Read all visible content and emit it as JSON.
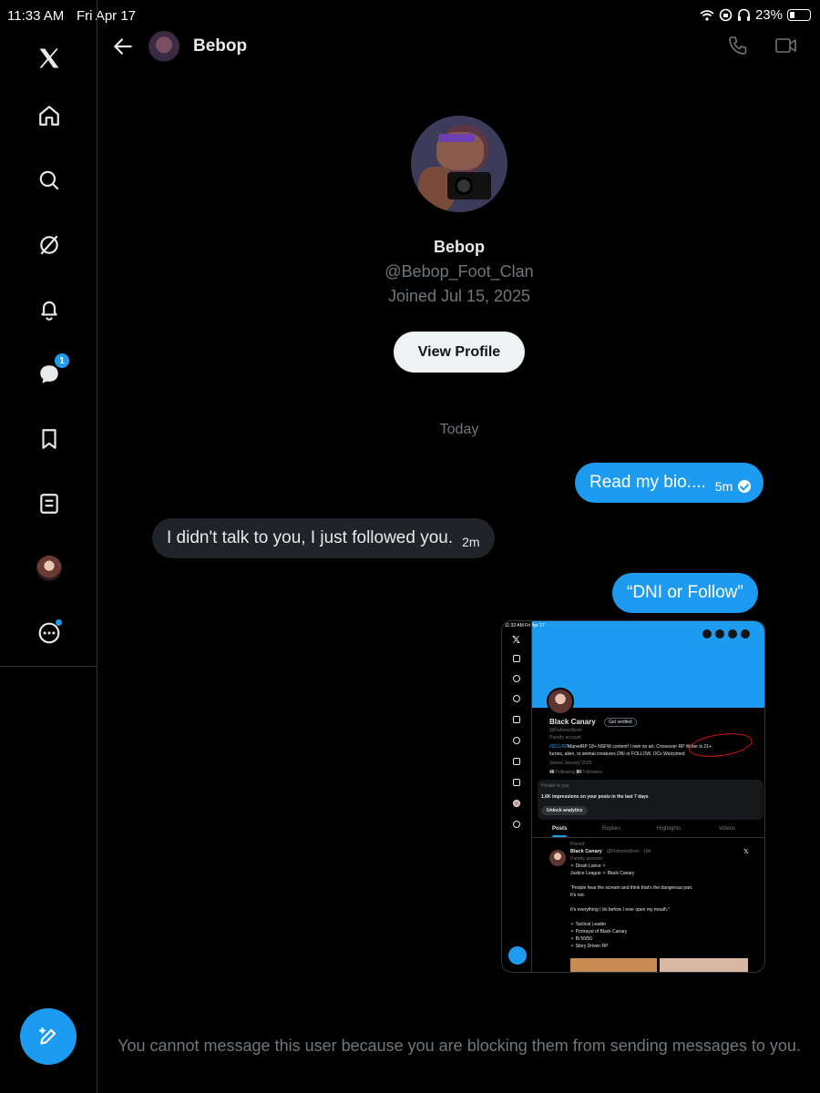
{
  "status_bar": {
    "time": "11:33 AM",
    "date": "Fri Apr 17",
    "battery": "23%",
    "battery_level": 0.23
  },
  "sidebar": {
    "items": [
      {
        "name": "x-logo"
      },
      {
        "name": "home-icon"
      },
      {
        "name": "search-icon"
      },
      {
        "name": "grok-icon"
      },
      {
        "name": "notifications-icon"
      },
      {
        "name": "messages-icon",
        "badge": "1"
      },
      {
        "name": "bookmarks-icon"
      },
      {
        "name": "lists-icon"
      },
      {
        "name": "profile-avatar"
      },
      {
        "name": "more-icon"
      }
    ],
    "compose_icon": "compose-icon"
  },
  "header": {
    "name": "Bebop"
  },
  "profile": {
    "name": "Bebop",
    "handle": "@Bebop_Foot_Clan",
    "joined": "Joined Jul 15, 2025",
    "view_profile": "View Profile"
  },
  "day_separator": "Today",
  "messages": [
    {
      "direction": "sent",
      "text": "Read my bio....",
      "time": "5m",
      "read": true
    },
    {
      "direction": "received",
      "text": "I didn't talk to you, I just followed you.",
      "time": "2m"
    },
    {
      "direction": "sent",
      "text": "“DNI or Follow”"
    }
  ],
  "attachment": {
    "status_time": "11:32 AM",
    "status_date": "Fri Apr 17",
    "name": "Black Canary",
    "get_verified": "Get verified",
    "handle": "@FishnetsSiren",
    "parody": "Parody account",
    "bio_tag": "#DCURP",
    "bio_line1": "MarvelRP 18+ NSFW content! I own no art. Crossover RP Writer is 21+.",
    "bio_line2": "furries, alien, or animal creatures DNI or FOLLOW. OCs Welcomed",
    "joined": "Joined January 2025",
    "following_count": "46",
    "following_label": "Following",
    "followers_count": "80",
    "followers_label": "Followers",
    "private_label": "Private to you",
    "impressions": "1.6K impressions on your posts in the last 7 days",
    "unlock": "Unlock analytics",
    "tabs": [
      "Posts",
      "Replies",
      "Highlights",
      "Videos"
    ],
    "pinned": "Pinned",
    "post_name": "Black Canary",
    "post_handle": "@FishnetsSiren · 18h",
    "post_parody": "Parody account",
    "post_lines": [
      "✧ Dinah Lance ✧",
      "Justice League ✧ Black Canary",
      "",
      "“People hear the scream and think that’s the dangerous part.",
      "It’s not.",
      "",
      "It’s everything I do before I ever open my mouth.”",
      "",
      "✧ Tactical Leader",
      "✧ Portrayal of Black Canary",
      "✧ Bi 50/50",
      "✧ Story Driven RP"
    ]
  },
  "footer": "You cannot message this user because you are blocking them from sending messages to you.",
  "colors": {
    "accent": "#1d9bf0",
    "background": "#000000",
    "muted": "#71767b",
    "received_bubble": "#202327"
  }
}
